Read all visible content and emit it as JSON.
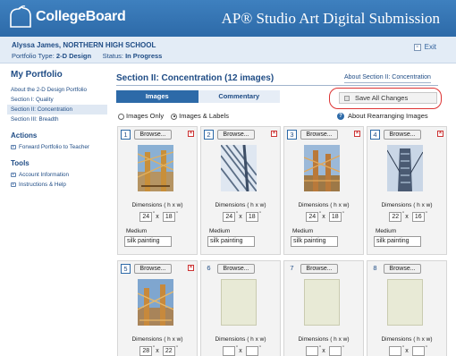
{
  "header": {
    "logo_text": "CollegeBoard",
    "app_title": "AP® Studio Art Digital Submission"
  },
  "user": {
    "name": "Alyssa James, NORTHERN HIGH SCHOOL",
    "portfolio_type_label": "Portfolio Type:",
    "portfolio_type": "2-D Design",
    "status_label": "Status:",
    "status": "In Progress",
    "exit_label": "Exit"
  },
  "sidebar": {
    "title": "My Portfolio",
    "items": [
      {
        "label": "About the 2-D Design Portfolio"
      },
      {
        "label": "Section I: Quality"
      },
      {
        "label": "Section II: Concentration"
      },
      {
        "label": "Section III: Breadth"
      }
    ],
    "actions_title": "Actions",
    "actions": [
      {
        "label": "Forward Portfolio to Teacher"
      }
    ],
    "tools_title": "Tools",
    "tools": [
      {
        "label": "Account Information"
      },
      {
        "label": "Instructions & Help"
      }
    ]
  },
  "main": {
    "section_title": "Section II: Concentration (12 images)",
    "about_link": "About Section II: Concentration",
    "tabs": [
      {
        "label": "Images"
      },
      {
        "label": "Commentary"
      }
    ],
    "save_label": "Save All Changes",
    "view_options": [
      {
        "label": "Images Only",
        "selected": false
      },
      {
        "label": "Images & Labels",
        "selected": true
      }
    ],
    "help_label": "About Rearranging Images",
    "browse_label": "Browse...",
    "dimensions_label": "Dimensions  (  h x w)",
    "x_label": "x",
    "medium_label": "Medium",
    "cards": [
      {
        "num": "1",
        "h": "24",
        "w": "18",
        "medium": "silk painting",
        "has_image": true,
        "art": "bridge-a"
      },
      {
        "num": "2",
        "h": "24",
        "w": "18",
        "medium": "silk painting",
        "has_image": true,
        "art": "cables"
      },
      {
        "num": "3",
        "h": "24",
        "w": "18",
        "medium": "silk painting",
        "has_image": true,
        "art": "bridge-b"
      },
      {
        "num": "4",
        "h": "22",
        "w": "16",
        "medium": "silk painting",
        "has_image": true,
        "art": "tower"
      },
      {
        "num": "5",
        "h": "28",
        "w": "22",
        "medium": "",
        "has_image": true,
        "art": "bridge-c"
      },
      {
        "num": "6",
        "h": "",
        "w": "",
        "medium": "",
        "has_image": false
      },
      {
        "num": "7",
        "h": "",
        "w": "",
        "medium": "",
        "has_image": false
      },
      {
        "num": "8",
        "h": "",
        "w": "",
        "medium": "",
        "has_image": false
      }
    ]
  }
}
